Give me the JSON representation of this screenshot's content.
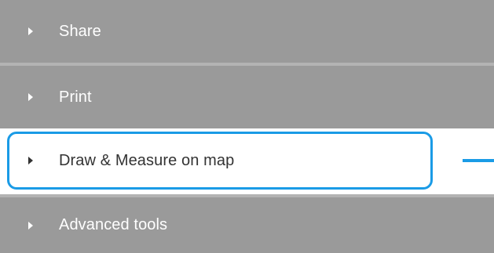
{
  "menu": {
    "items": [
      {
        "label": "Share",
        "icon": "caret-right-icon"
      },
      {
        "label": "Print",
        "icon": "caret-right-icon"
      },
      {
        "label": "Draw & Measure on map",
        "icon": "caret-right-icon"
      },
      {
        "label": "Advanced tools",
        "icon": "caret-right-icon"
      }
    ]
  },
  "colors": {
    "item_background": "#9a9a9a",
    "item_text": "#ffffff",
    "highlight": "#1a9be6",
    "selected_text": "#333333"
  }
}
